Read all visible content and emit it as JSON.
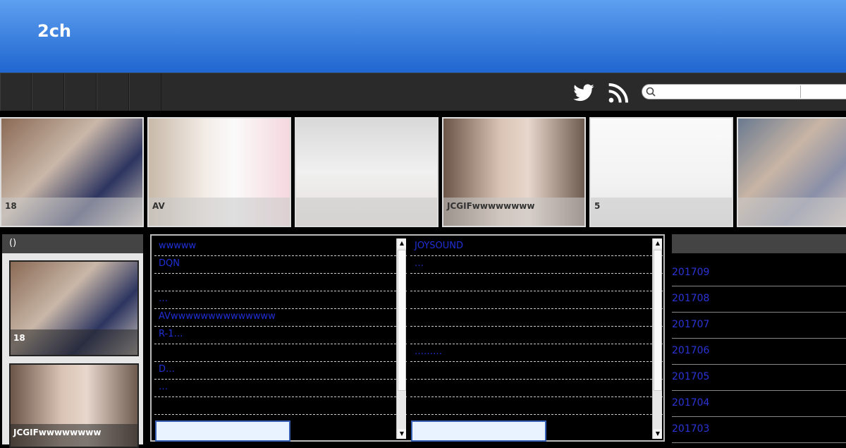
{
  "header": {
    "title": "2ch"
  },
  "search": {
    "placeholder": ""
  },
  "carousel": [
    {
      "caption": "18"
    },
    {
      "caption": "AV"
    },
    {
      "caption": ""
    },
    {
      "caption": "JCGIFwwwwwwww"
    },
    {
      "caption": "5"
    },
    {
      "caption": ""
    }
  ],
  "left": {
    "heading": "()",
    "items": [
      {
        "caption": "18"
      },
      {
        "caption": "JCGIFwwwwwwww"
      }
    ]
  },
  "feed_left": [
    "wwwww",
    "DQN",
    "",
    "…",
    "AVwwwwwwwwwwwwww",
    "R-1…",
    "",
    "D…",
    "…",
    "",
    ""
  ],
  "feed_right": [
    "JOYSOUND",
    "…",
    "",
    "",
    "",
    "",
    "………",
    "",
    "",
    "",
    ""
  ],
  "archive": [
    "201709",
    "201708",
    "201707",
    "201706",
    "201705",
    "201704",
    "201703"
  ],
  "colors": {
    "header_top": "#5e9ff0",
    "header_bottom": "#1f66cf",
    "link": "#1f2fd6"
  }
}
